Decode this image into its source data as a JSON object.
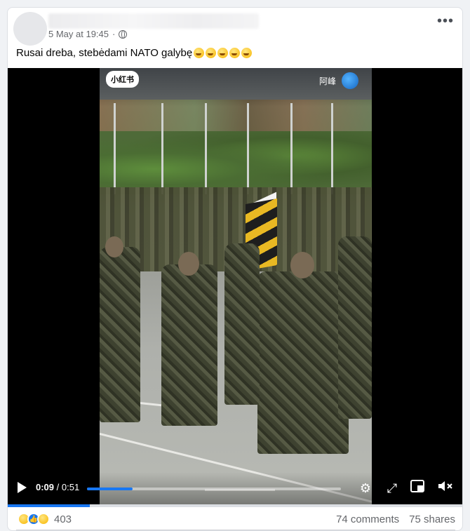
{
  "post": {
    "timestamp": "5 May at 19:45",
    "separator": "·",
    "caption": "Rusai dreba, stebėdami NATO galybę",
    "caption_emojis": [
      "winking-face",
      "winking-face",
      "grinning-face",
      "grinning-face",
      "grinning-face"
    ]
  },
  "video": {
    "watermark_left": "小红书",
    "watermark_right": "阿峰",
    "current_time": "0:09",
    "total_time": "/ 0:51",
    "progress": 0.18
  },
  "controls": {
    "icons": [
      "play-icon",
      "settings-icon",
      "fullscreen-icon",
      "picture-in-picture-icon",
      "mute-icon"
    ]
  },
  "footer": {
    "reaction_icons": [
      "haha-icon",
      "like-icon",
      "wow-icon"
    ],
    "reaction_count": "403",
    "comments": "74 comments",
    "shares": "75 shares"
  },
  "colors": {
    "accent": "#1877f2",
    "secondary_text": "#65676b",
    "background": "#f0f2f5"
  }
}
